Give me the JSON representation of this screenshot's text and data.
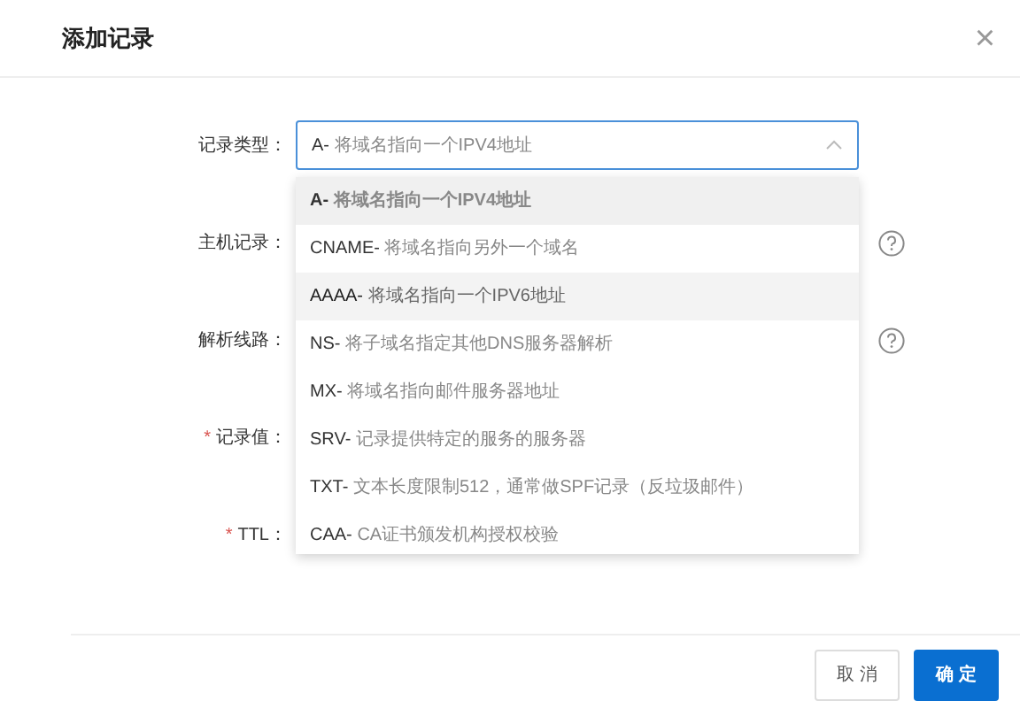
{
  "dialog": {
    "title": "添加记录",
    "close": "×"
  },
  "record_type": {
    "label": "记录类型：",
    "value": {
      "code": "A-",
      "description": "将域名指向一个IPV4地址"
    },
    "expanded": true
  },
  "fields": [
    {
      "label": "主机记录：",
      "help": true
    },
    {
      "label": "解析线路：",
      "help": true
    },
    {
      "label": "记录值：",
      "required_mark": "*",
      "help": false
    },
    {
      "label": "TTL：",
      "required_mark": "*",
      "help": false
    }
  ],
  "options": [
    {
      "code": "A-",
      "description": "将域名指向一个IPV4地址",
      "selected": true,
      "hovered": false
    },
    {
      "code": "CNAME-",
      "description": "将域名指向另外一个域名",
      "selected": false,
      "hovered": false
    },
    {
      "code": "AAAA-",
      "description": "将域名指向一个IPV6地址",
      "selected": false,
      "hovered": true
    },
    {
      "code": "NS-",
      "description": "将子域名指定其他DNS服务器解析",
      "selected": false,
      "hovered": false
    },
    {
      "code": "MX-",
      "description": "将域名指向邮件服务器地址",
      "selected": false,
      "hovered": false
    },
    {
      "code": "SRV-",
      "description": "记录提供特定的服务的服务器",
      "selected": false,
      "hovered": false
    },
    {
      "code": "TXT-",
      "description": "文本长度限制512，通常做SPF记录（反垃圾邮件）",
      "selected": false,
      "hovered": false
    },
    {
      "code": "CAA-",
      "description": "CA证书颁发机构授权校验",
      "selected": false,
      "hovered": false
    }
  ],
  "buttons": [
    {
      "label": "取 消",
      "kind": "secondary"
    },
    {
      "label": "确 定",
      "kind": "primary"
    }
  ]
}
